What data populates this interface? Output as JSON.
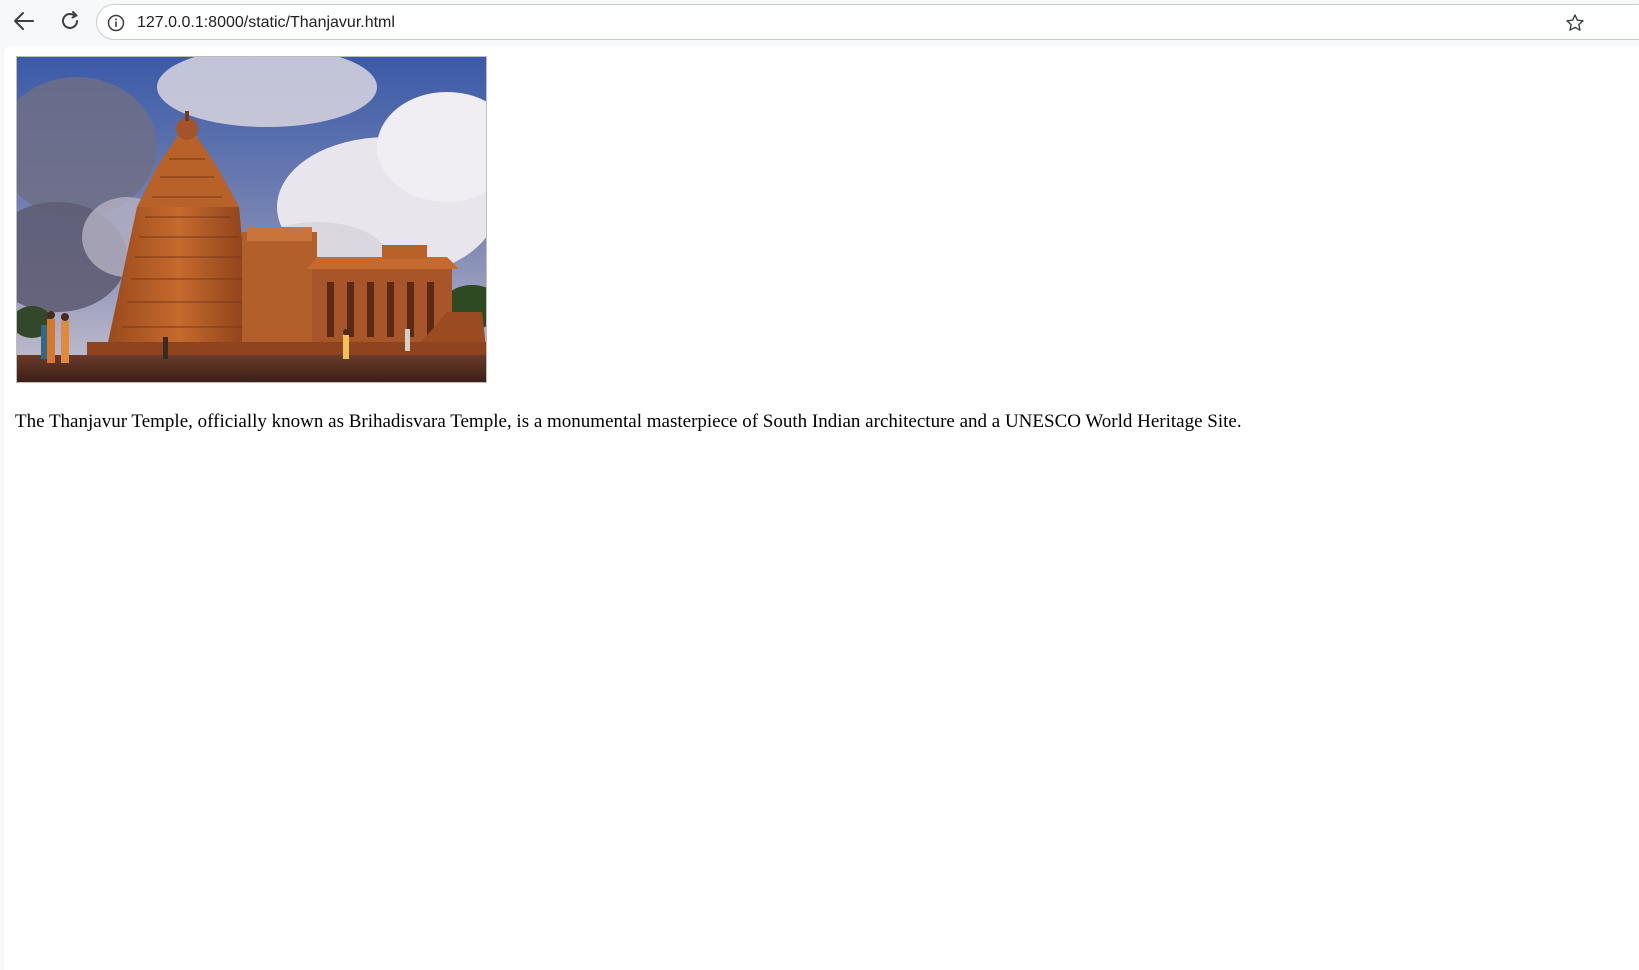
{
  "browser": {
    "url": "127.0.0.1:8000/static/Thanjavur.html",
    "icons": {
      "back": "arrow-left-icon",
      "reload": "reload-icon",
      "site_info": "info-icon",
      "bookmark": "star-icon"
    }
  },
  "page": {
    "image": {
      "subject": "Brihadisvara Temple, Thanjavur"
    },
    "description": "The Thanjavur Temple, officially known as Brihadisvara Temple, is a monumental masterpiece of South Indian architecture and a UNESCO World Heritage Site."
  },
  "colors": {
    "toolbar_bg": "#f7f8fa",
    "omnibox_border": "#c9cdd3",
    "page_bg": "#ffffff",
    "text": "#000000"
  }
}
